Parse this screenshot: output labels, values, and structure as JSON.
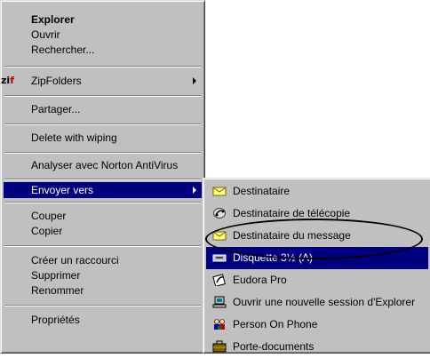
{
  "main_menu": {
    "items": [
      {
        "label": "Explorer",
        "bold": true
      },
      {
        "label": "Ouvrir"
      },
      {
        "label": "Rechercher..."
      },
      {
        "label": "ZipFolders",
        "icon_text": "zif"
      },
      {
        "label": "Partager..."
      },
      {
        "label": "Delete with wiping"
      },
      {
        "label": "Analyser avec Norton AntiVirus"
      },
      {
        "label": "Envoyer vers"
      },
      {
        "label": "Couper"
      },
      {
        "label": "Copier"
      },
      {
        "label": "Créer un raccourci"
      },
      {
        "label": "Supprimer"
      },
      {
        "label": "Renommer"
      },
      {
        "label": "Propriétés"
      }
    ]
  },
  "send_to_menu": {
    "items": [
      {
        "label": "Destinataire",
        "icon": "envelope-icon"
      },
      {
        "label": "Destinataire de télécopie",
        "icon": "fax-icon"
      },
      {
        "label": "Destinataire du message",
        "icon": "envelope-icon"
      },
      {
        "label": "Disquette 3½ (A)",
        "icon": "floppy-drive-icon"
      },
      {
        "label": "Eudora Pro",
        "icon": "eudora-icon"
      },
      {
        "label": "Ouvrir une nouvelle session d'Explorer",
        "icon": "computer-icon"
      },
      {
        "label": "Person On Phone",
        "icon": "person-on-phone-icon"
      },
      {
        "label": "Porte-documents",
        "icon": "briefcase-icon"
      }
    ]
  },
  "colors": {
    "menu_face": "#c0c0c0",
    "highlight": "#000080",
    "highlight_text": "#ffffff"
  }
}
